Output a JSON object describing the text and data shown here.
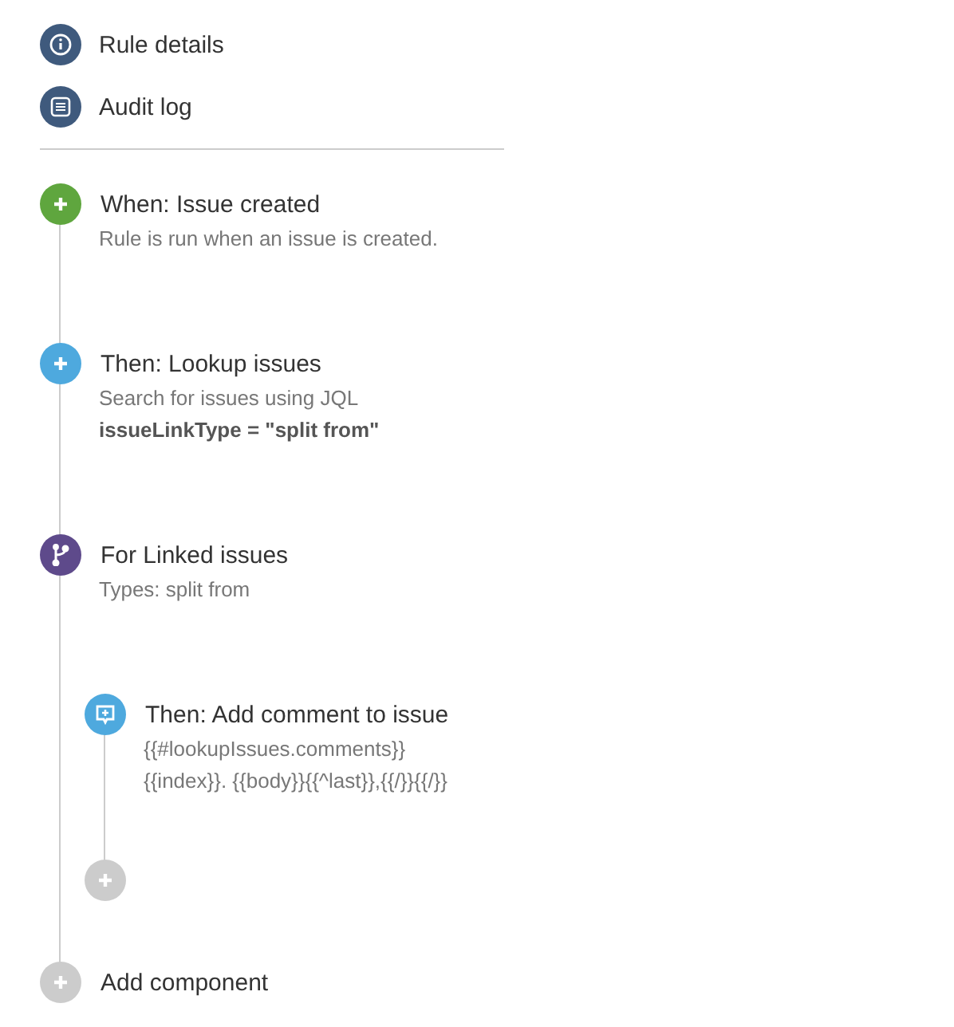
{
  "nav": [
    {
      "kind": "info",
      "label": "Rule details"
    },
    {
      "kind": "log",
      "label": "Audit log"
    }
  ],
  "steps": [
    {
      "kind": "trigger",
      "title": "When: Issue created",
      "lines": [
        {
          "text": "Rule is run when an issue is created.",
          "bold": false
        }
      ]
    },
    {
      "kind": "action",
      "title": "Then: Lookup issues",
      "lines": [
        {
          "text": "Search for issues using JQL",
          "bold": false
        },
        {
          "text": "issueLinkType = \"split from\"",
          "bold": true
        }
      ]
    },
    {
      "kind": "branch",
      "title": "For Linked issues",
      "lines": [
        {
          "text": "Types: split from",
          "bold": false
        }
      ],
      "children": [
        {
          "kind": "comment",
          "title": "Then: Add comment to issue",
          "lines": [
            {
              "text": "{{#lookupIssues.comments}}",
              "bold": false
            },
            {
              "text": "{{index}}. {{body}}{{^last}},{{/}}{{/}}",
              "bold": false
            }
          ]
        }
      ]
    }
  ],
  "add_component": {
    "label": "Add component"
  }
}
